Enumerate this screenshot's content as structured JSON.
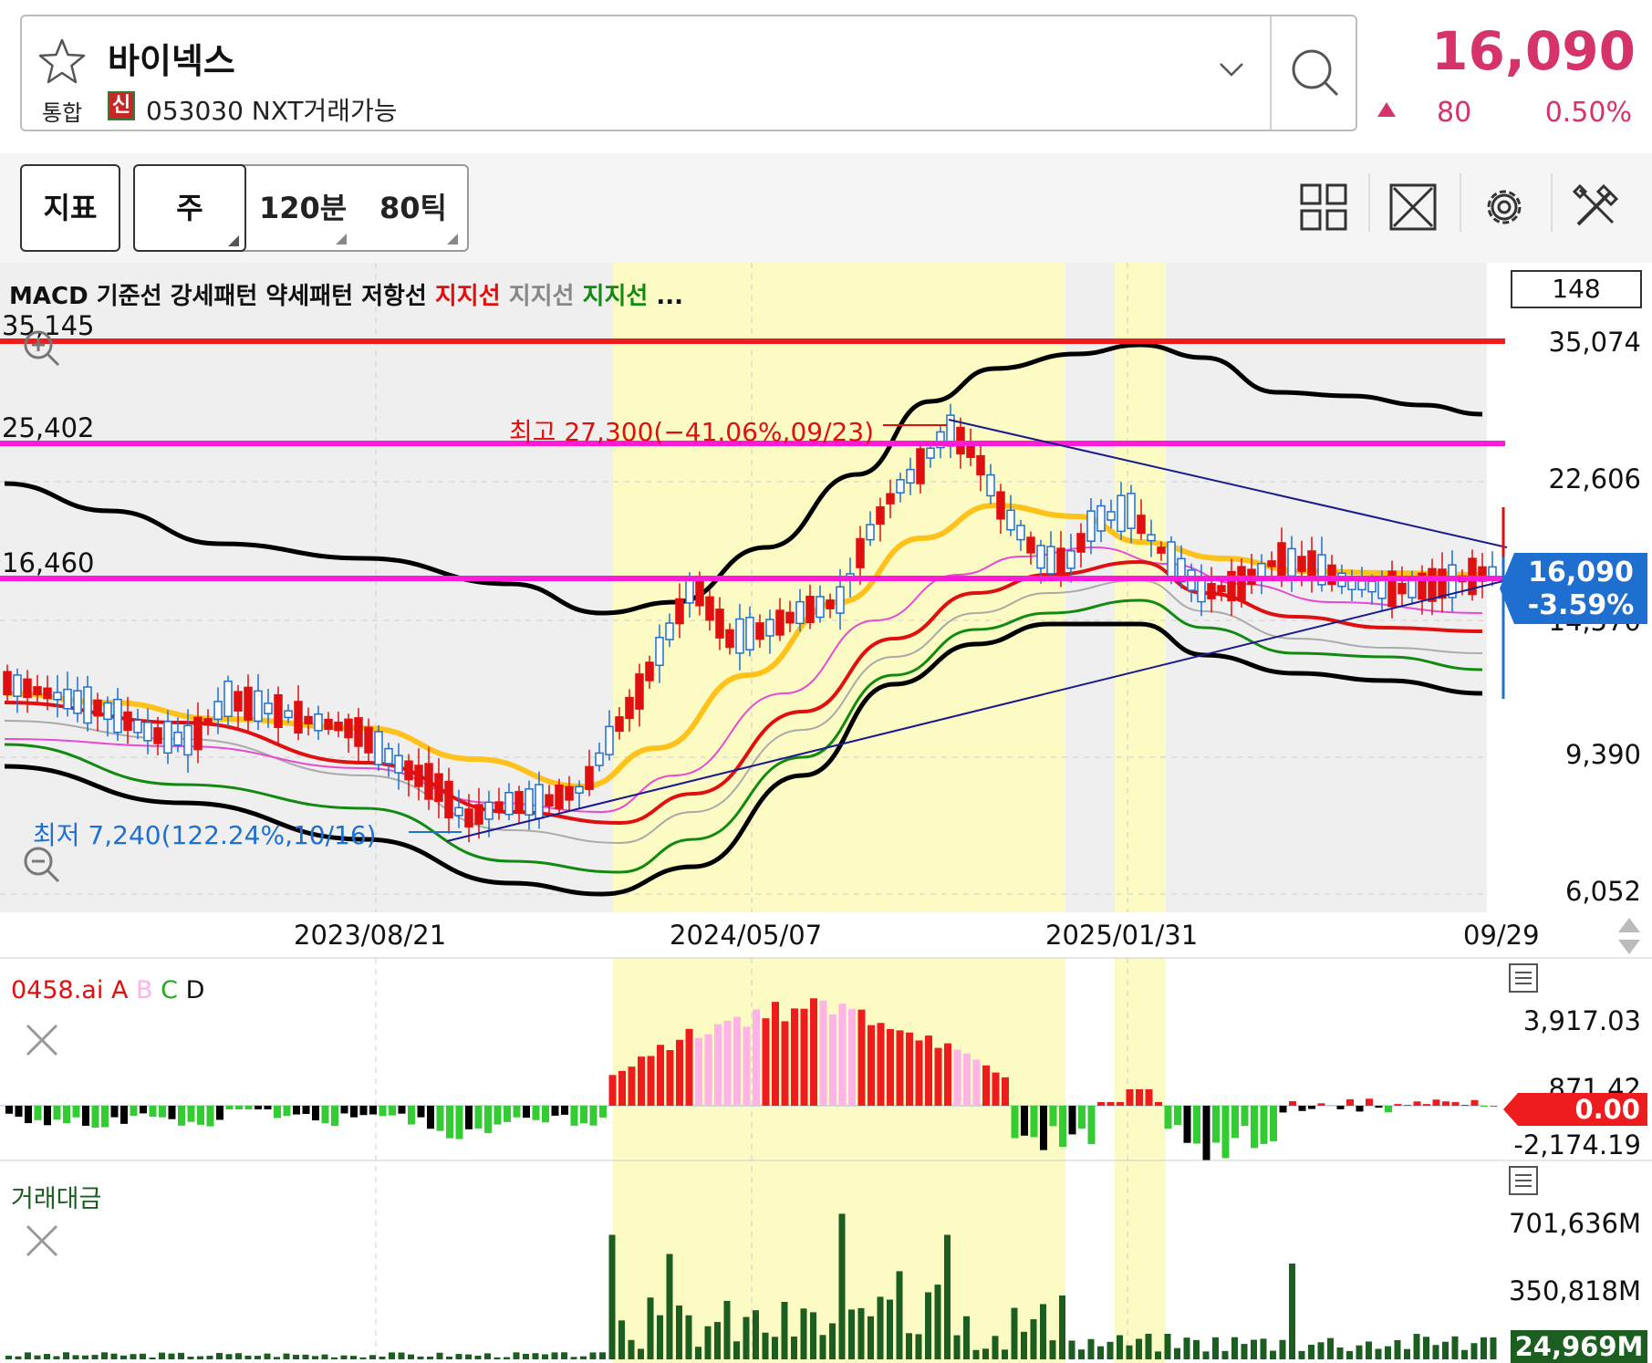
{
  "header": {
    "stock_name": "바이넥스",
    "market": "통합",
    "credit_badge": "신",
    "code_line": "053030 NXT거래가능",
    "price": "16,090",
    "change_abs": "80",
    "change_pct": "0.50%",
    "price_color": "#d6336c"
  },
  "toolbar": {
    "indicator_label": "지표",
    "period_week": "주",
    "period_120m": "120분",
    "period_80tick": "80틱",
    "icons": [
      "grid-icon",
      "fullscreen-icon",
      "settings-icon",
      "tools-icon"
    ]
  },
  "main_chart": {
    "legend": {
      "macd": "MACD",
      "base": "기준선",
      "strong": "강세패턴",
      "weak": "약세패턴",
      "resist": "저항선",
      "support1": "지지선",
      "support2": "지지선",
      "support3": "지지선",
      "more": "..."
    },
    "count_box": "148",
    "left_levels": [
      "35,145",
      "25,402",
      "16,460"
    ],
    "right_axis": [
      "35,074",
      "22,606",
      "14,570",
      "9,390",
      "6,052"
    ],
    "high_note": "최고 27,300(−41.06%,09/23)",
    "low_note": "최저 7,240(122.24%,10/16)",
    "current_price": "16,090",
    "current_change": "-3.59%",
    "x_axis": [
      "2023/08/21",
      "2024/05/07",
      "2025/01/31",
      "09/29"
    ],
    "accent_red": "#ee1c1c",
    "accent_magenta": "#ff1ad9",
    "accent_blue": "#1e6fd0"
  },
  "osc_panel": {
    "legend_name": "0458.ai",
    "legend_a": "A",
    "legend_b": "B",
    "legend_c": "C",
    "legend_d": "D",
    "axis": [
      "3,917.03",
      "871.42",
      "-2,174.19"
    ],
    "current": "0.00"
  },
  "volume_panel": {
    "title": "거래대금",
    "axis": [
      "701,636M",
      "350,818M"
    ],
    "current": "24,969M"
  },
  "chart_data": [
    {
      "type": "candlestick",
      "title": "",
      "x_ticks": [
        "2023/08/21",
        "2024/05/07",
        "2025/01/31",
        "09/29"
      ],
      "ylim": [
        6052,
        35074
      ],
      "y_ticks": [
        35074,
        22606,
        14570,
        9390,
        6052
      ],
      "high": {
        "value": 27300,
        "date": "09/23",
        "pct": -41.06
      },
      "low": {
        "value": 7240,
        "date": "10/16",
        "pct": 122.24
      },
      "last": 16090,
      "horizontal_levels": [
        35145,
        25402,
        16460
      ]
    },
    {
      "type": "bar",
      "title": "0458.ai",
      "y_ticks": [
        3917.03,
        871.42,
        -2174.19
      ],
      "last": 0.0
    },
    {
      "type": "bar",
      "title": "거래대금",
      "y_ticks_M": [
        701636,
        350818
      ],
      "last_M": 24969
    }
  ]
}
